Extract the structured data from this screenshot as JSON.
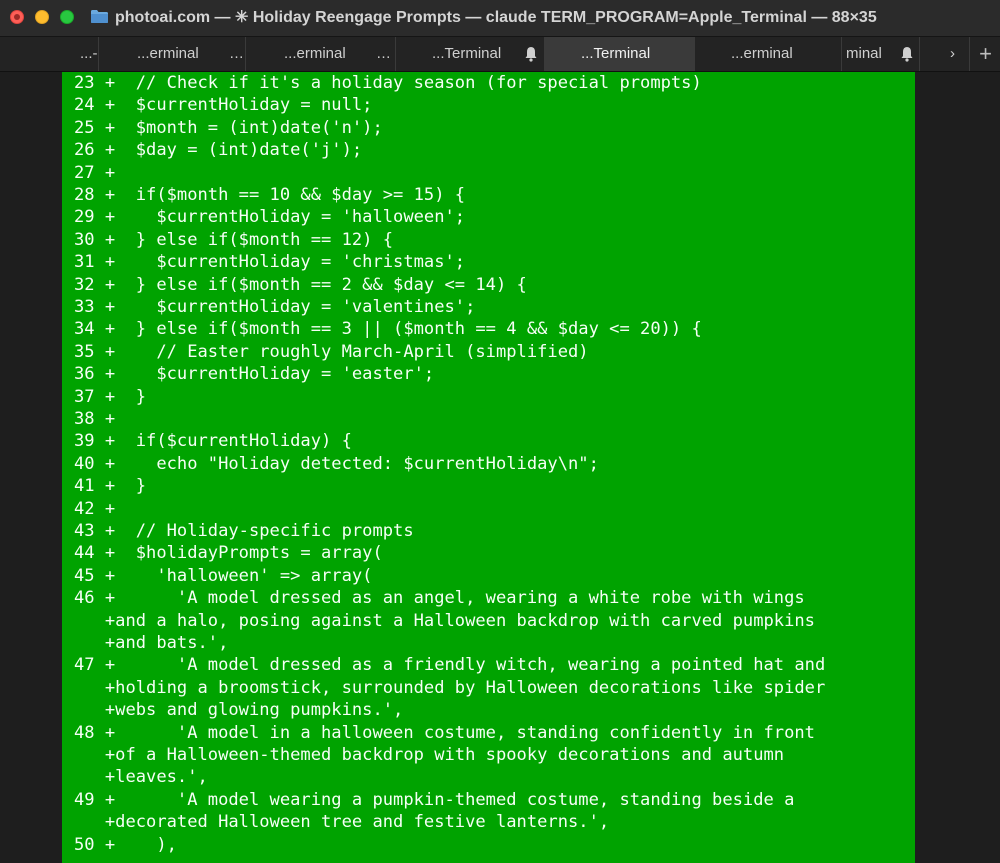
{
  "window": {
    "title": "photoai.com — ✳ Holiday Reengage Prompts — claude TERM_PROGRAM=Apple_Terminal — 88×35",
    "tabs": [
      {
        "label": "...-",
        "has_dots": false
      },
      {
        "label": "...erminal",
        "has_dots": true
      },
      {
        "label": "...erminal",
        "has_dots": true
      },
      {
        "label": "...Terminal",
        "has_bell": true
      },
      {
        "label": "...Terminal",
        "active": true
      },
      {
        "label": "...erminal"
      },
      {
        "label": "minal",
        "has_bell": true
      }
    ],
    "new_tab": "+"
  },
  "colors": {
    "pane": "#00a300",
    "text": "#f5fff5"
  },
  "lines": [
    "23 +  // Check if it's a holiday season (for special prompts)",
    "24 +  $currentHoliday = null;",
    "25 +  $month = (int)date('n');",
    "26 +  $day = (int)date('j');",
    "27 +",
    "28 +  if($month == 10 && $day >= 15) {",
    "29 +    $currentHoliday = 'halloween';",
    "30 +  } else if($month == 12) {",
    "31 +    $currentHoliday = 'christmas';",
    "32 +  } else if($month == 2 && $day <= 14) {",
    "33 +    $currentHoliday = 'valentines';",
    "34 +  } else if($month == 3 || ($month == 4 && $day <= 20)) {",
    "35 +    // Easter roughly March-April (simplified)",
    "36 +    $currentHoliday = 'easter';",
    "37 +  }",
    "38 +",
    "39 +  if($currentHoliday) {",
    "40 +    echo \"Holiday detected: $currentHoliday\\n\";",
    "41 +  }",
    "42 +",
    "43 +  // Holiday-specific prompts",
    "44 +  $holidayPrompts = array(",
    "45 +    'halloween' => array(",
    "46 +      'A model dressed as an angel, wearing a white robe with wings",
    "   +and a halo, posing against a Halloween backdrop with carved pumpkins",
    "   +and bats.',",
    "47 +      'A model dressed as a friendly witch, wearing a pointed hat and",
    "   +holding a broomstick, surrounded by Halloween decorations like spider",
    "   +webs and glowing pumpkins.',",
    "48 +      'A model in a halloween costume, standing confidently in front",
    "   +of a Halloween-themed backdrop with spooky decorations and autumn",
    "   +leaves.',",
    "49 +      'A model wearing a pumpkin-themed costume, standing beside a",
    "   +decorated Halloween tree and festive lanterns.',",
    "50 +    ),"
  ]
}
